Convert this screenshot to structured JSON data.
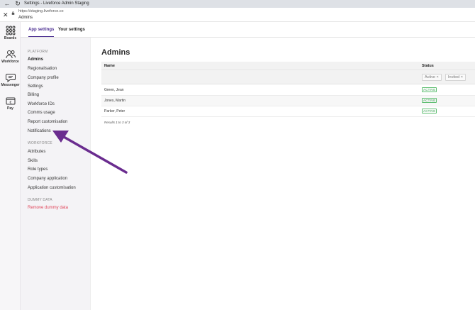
{
  "browser": {
    "tab_title": "Settings - Liveforce Admin Staging",
    "url": "https://staging.liveforce.co",
    "page_label": "Admins"
  },
  "rail": {
    "items": [
      {
        "label": "Boards",
        "icon": "grid-icon"
      },
      {
        "label": "Workforce",
        "icon": "people-icon"
      },
      {
        "label": "Messenger",
        "icon": "chat-icon"
      },
      {
        "label": "Pay",
        "icon": "wallet-icon"
      }
    ]
  },
  "tabs": [
    {
      "label": "App settings",
      "active": true
    },
    {
      "label": "Your settings",
      "active": false
    }
  ],
  "sidebar": {
    "platform_heading": "PLATFORM",
    "platform_items": [
      "Admins",
      "Regionalisation",
      "Company profile",
      "Settings",
      "Billing",
      "Workforce IDs",
      "Comms usage",
      "Report customisation",
      "Notifications"
    ],
    "workforce_heading": "WORKFORCE",
    "workforce_items": [
      "Attributes",
      "Skills",
      "Role types",
      "Company application",
      "Application customisation"
    ],
    "dummy_heading": "DUMMY DATA",
    "dummy_items": [
      "Remove dummy data"
    ]
  },
  "main": {
    "title": "Admins",
    "columns": {
      "name": "Name",
      "status": "Status"
    },
    "filters": [
      "Active",
      "Invited"
    ],
    "rows": [
      {
        "name": "Green, Jean",
        "status": "ACTIVE"
      },
      {
        "name": "Jones, Martin",
        "status": "ACTIVE"
      },
      {
        "name": "Parker, Peter",
        "status": "ACTIVE"
      }
    ],
    "results_text": "Results 1 to 3 of 3"
  },
  "annotation": {
    "arrow_color": "#6a2c8f"
  }
}
